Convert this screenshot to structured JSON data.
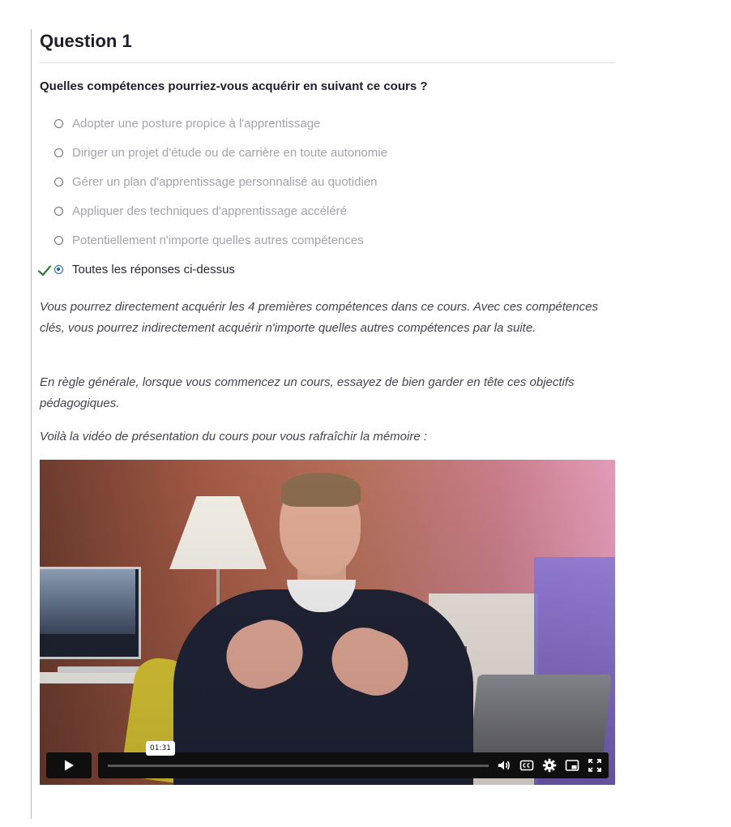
{
  "question": {
    "title": "Question 1",
    "prompt": "Quelles compétences pourriez-vous acquérir en suivant ce cours ?",
    "options": [
      {
        "label": "Adopter une posture propice à l'apprentissage",
        "selected": false,
        "correct": false
      },
      {
        "label": "Diriger un projet d'étude ou de carrière en toute autonomie",
        "selected": false,
        "correct": false
      },
      {
        "label": "Gérer un plan d'apprentissage personnalisé au quotidien",
        "selected": false,
        "correct": false
      },
      {
        "label": "Appliquer des techniques d'apprentissage accéléré",
        "selected": false,
        "correct": false
      },
      {
        "label": "Potentiellement n'importe quelles autres compétences",
        "selected": false,
        "correct": false
      },
      {
        "label": "Toutes les réponses ci-dessus",
        "selected": true,
        "correct": true
      }
    ]
  },
  "feedback": {
    "p1": "Vous pourrez directement acquérir les 4 premières compétences dans ce cours. Avec ces compétences clés, vous pourrez indirectement acquérir n'importe quelles autres compétences par la suite.",
    "p2": "En règle générale, lorsque vous commencez un cours, essayez de bien garder en tête ces objectifs pédagogiques.",
    "p3": "Voilà la vidéo de présentation du cours pour vous rafraîchir la mémoire :"
  },
  "video": {
    "hover_time": "01:31",
    "progress": 0.0,
    "icons": [
      "play-icon",
      "volume-icon",
      "captions-icon",
      "settings-icon",
      "picture-in-picture-icon",
      "fullscreen-icon"
    ]
  },
  "colors": {
    "check": "#2e7d32",
    "radio_selected": "#0a66c2",
    "muted_option": "#a3a3aa"
  }
}
